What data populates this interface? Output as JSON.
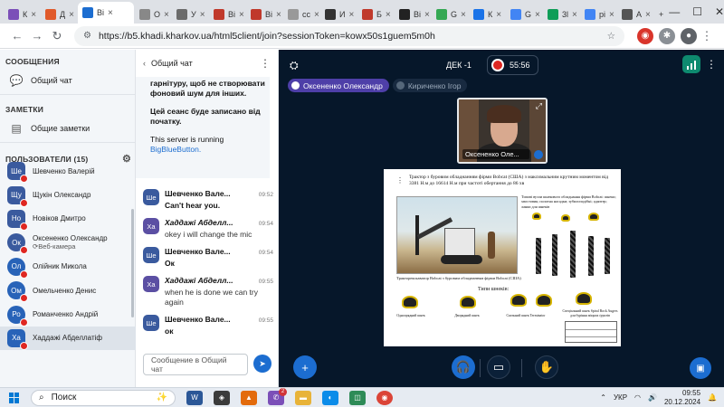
{
  "browser": {
    "tabs": [
      {
        "label": "К",
        "color": "#7b4fb8"
      },
      {
        "label": "Д",
        "color": "#e05a2b"
      },
      {
        "label": "Bi",
        "color": "#1c6dd0",
        "active": true
      },
      {
        "label": "О",
        "color": "#888888"
      },
      {
        "label": "У",
        "color": "#6b6b6b"
      },
      {
        "label": "Bi",
        "color": "#c0392b"
      },
      {
        "label": "Bi",
        "color": "#c0392b"
      },
      {
        "label": "cc",
        "color": "#999999"
      },
      {
        "label": "И",
        "color": "#333333"
      },
      {
        "label": "Б",
        "color": "#c0392b"
      },
      {
        "label": "Bi",
        "color": "#222222"
      },
      {
        "label": "G",
        "color": "#34a853"
      },
      {
        "label": "К",
        "color": "#1a73e8"
      },
      {
        "label": "G",
        "color": "#4285f4"
      },
      {
        "label": "3l",
        "color": "#0f9d58"
      },
      {
        "label": "pi",
        "color": "#4285f4"
      },
      {
        "label": "А",
        "color": "#555555"
      }
    ],
    "url": "https://b5.khadi.kharkov.ua/html5client/join?sessionToken=kowx50s1guem5m0h"
  },
  "sidebar": {
    "messages_heading": "СООБЩЕНИЯ",
    "public_chat": "Общий чат",
    "notes_heading": "ЗАМЕТКИ",
    "shared_notes": "Общие заметки",
    "users_heading": "ПОЛЬЗОВАТЕЛИ (15)",
    "users": [
      {
        "initials": "Ше",
        "name": "Шевченко Валерій",
        "color": "#3a5a9e",
        "round": false
      },
      {
        "initials": "Щу",
        "name": "Щукін Олександр",
        "color": "#3a5a9e",
        "round": false
      },
      {
        "initials": "Но",
        "name": "Новіков Дмитро",
        "color": "#3a5a9e",
        "round": false
      },
      {
        "initials": "Ок",
        "name": "Оксененко Олександр",
        "sub": "Веб-камера",
        "color": "#3a5a9e",
        "round": true
      },
      {
        "initials": "Ол",
        "name": "Олійник Микола",
        "color": "#2863b8",
        "round": true
      },
      {
        "initials": "Ом",
        "name": "Омельченко Денис",
        "color": "#2863b8",
        "round": true
      },
      {
        "initials": "Ро",
        "name": "Романченко Андрій",
        "color": "#2863b8",
        "round": true
      },
      {
        "initials": "Ха",
        "name": "Хаддажі Абделлатіф",
        "color": "#2863b8",
        "round": false,
        "selected": true
      }
    ]
  },
  "chat": {
    "title": "Общий чат",
    "welcome_1": "гарнітуру, щоб не створювати фоновий шум для інших.",
    "welcome_2": "Цей сеанс буде записано від початку.",
    "server_text": "This server is running",
    "server_link": "BigBlueButton.",
    "messages": [
      {
        "initials": "Ше",
        "author": "Шевченко Вале...",
        "time": "09:52",
        "text": "Can't hear you.",
        "bold": true,
        "italic": false,
        "color": "#3a5a9e"
      },
      {
        "initials": "Ха",
        "author": "Хаддажі Абделл...",
        "time": "09:54",
        "text": "okey i will change the mic",
        "bold": false,
        "italic": true,
        "color": "#5b4fa3"
      },
      {
        "initials": "Ше",
        "author": "Шевченко Вале...",
        "time": "09:54",
        "text": "Ок",
        "bold": true,
        "italic": false,
        "color": "#3a5a9e"
      },
      {
        "initials": "Ха",
        "author": "Хаддажі Абделл...",
        "time": "09:55",
        "text": "when he is done we can try again",
        "bold": false,
        "italic": true,
        "color": "#5b4fa3"
      },
      {
        "initials": "Ше",
        "author": "Шевченко Вале...",
        "time": "09:55",
        "text": "ок",
        "bold": true,
        "italic": false,
        "color": "#3a5a9e"
      }
    ],
    "input_placeholder": "Сообщение в Общий чат"
  },
  "main": {
    "meeting_title": "ДЕК -1",
    "timer": "55:56",
    "talking": [
      "Оксененко Олександр",
      "Кириченко Ігор"
    ],
    "webcam_label": "Оксененко Оле...",
    "slide": {
      "title": "Трактор з буровим обладнанням фірми Bobcat (США) з максимальним крутним моментом від 3381 Н.м до 16614 Н.м при частоті обертання до 86 хв",
      "photo_caption": "Тракторекскаватор Bobcat з буровим обладнанням фірми Bobcat (США)",
      "right_text": "Типові вузли шнекового обладнання фірми Bobcat: шнеки; хвостовик; полотна насадки; зубилоподібні; адаптер; ланки для шнеків",
      "types_heading": "Типи шнеків:",
      "captions": [
        "Одноорядний шнек",
        "Дворядний шнек",
        "Скельний шнек Terminator",
        "Спеціальний шнек Spiral Rock Augers для буріння міцних ґрунтів"
      ]
    }
  },
  "taskbar": {
    "search": "Поиск",
    "lang": "УКР",
    "time": "09:55",
    "date": "20.12.2024",
    "badge": "2"
  }
}
